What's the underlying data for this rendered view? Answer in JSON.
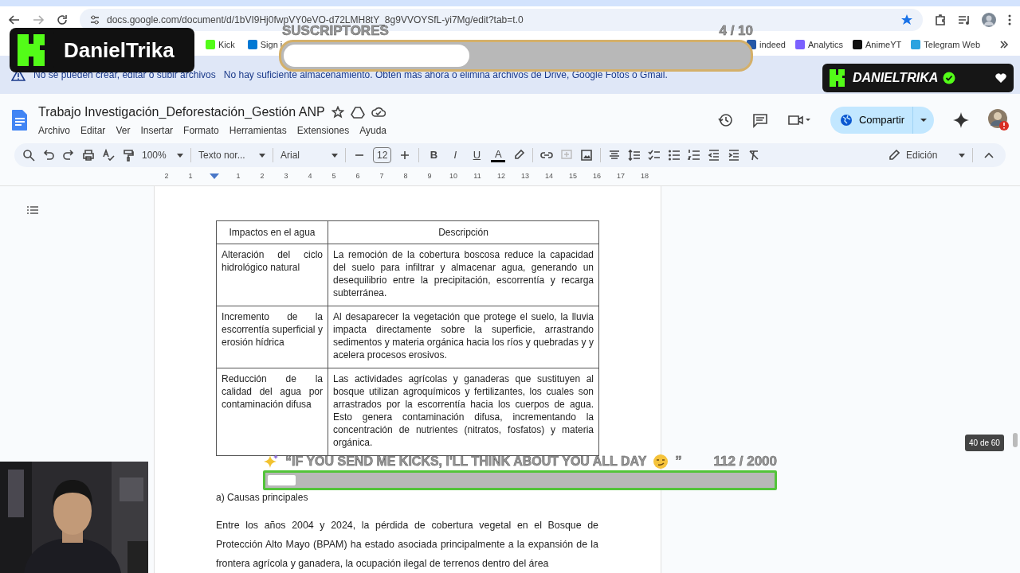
{
  "browser": {
    "url": "docs.google.com/document/d/1bVI9Hj0fwpVY0eVO-d72LMH8tY_8g9VVOYSfL-yi7Mg/edit?tab=t.0",
    "bookmarks": [
      {
        "label": "Kick",
        "color": "#53fc18"
      },
      {
        "label": "Sign i",
        "color": "#0078d4"
      },
      {
        "label": "indeed",
        "color": "#2557a7"
      },
      {
        "label": "Analytics",
        "color": "#7b61ff"
      },
      {
        "label": "AnimeYT",
        "color": "#111111"
      },
      {
        "label": "Telegram Web",
        "color": "#2aa3e0"
      }
    ]
  },
  "banner": {
    "title": "No se pueden crear, editar o subir archivos",
    "message": "No hay suficiente almacenamiento. Obtén más ahora o elimina archivos de Drive, Google Fotos o Gmail."
  },
  "doc": {
    "title": "Trabajo Investigación_Deforestación_Gestión ANP",
    "menus": [
      "Archivo",
      "Editar",
      "Ver",
      "Insertar",
      "Formato",
      "Herramientas",
      "Extensiones",
      "Ayuda"
    ],
    "share": "Compartir",
    "toolbar": {
      "zoom": "100%",
      "style": "Texto nor...",
      "font": "Arial",
      "size": "12",
      "format_letters": [
        "B",
        "I",
        "U",
        "A"
      ],
      "mode": "Edición"
    },
    "ruler": [
      "2",
      "1",
      "1",
      "2",
      "3",
      "4",
      "5",
      "6",
      "7",
      "8",
      "9",
      "10",
      "11",
      "12",
      "13",
      "14",
      "15",
      "16",
      "17",
      "18"
    ],
    "table": {
      "columns": [
        "Impactos en el agua",
        "Descripción"
      ],
      "rows": [
        [
          "Alteración del ciclo hidrológico natural",
          "La remoción de la cobertura boscosa reduce la capacidad del suelo para infiltrar y almacenar agua, generando un desequilibrio entre la precipitación, escorrentía y recarga subterránea."
        ],
        [
          "Incremento de la escorrentía superficial y erosión hídrica",
          "Al desaparecer la vegetación que protege el suelo, la lluvia impacta directamente sobre la superficie, arrastrando sedimentos y materia orgánica hacia los ríos y quebradas y y acelera procesos erosivos."
        ],
        [
          "Reducción de la calidad del agua por contaminación difusa",
          "Las actividades agrícolas y ganaderas que sustituyen al bosque utilizan agroquímicos y fertilizantes, los cuales son arrastrados por la escorrentía hacia los cuerpos de agua. Esto genera contaminación difusa, incrementando la concentración de nutrientes (nitratos, fosfatos) y materia orgánica."
        ]
      ]
    },
    "heading": "a) Causas principales",
    "paragraph": "Entre los años 2004 y 2024, la pérdida de cobertura vegetal en el Bosque de Protección Alto Mayo (BPAM) ha estado asociada principalmente a la expansión de la frontera agrícola y ganadera, la ocupación ilegal de terrenos dentro del área",
    "page_indicator": "40 de 60"
  },
  "overlays": {
    "logo": "DanielTrika",
    "badge": "DANIELTRIKA",
    "subs_goal": {
      "label": "SUSCRIPTORES",
      "count": "4  / 10",
      "level": 0.4
    },
    "kicks_goal": {
      "label": "“IF YOU SEND ME KICKS, I'LL THINK ABOUT YOU ALL DAY",
      "close_quote": "”",
      "count": "112  / 2000",
      "level": 0.056
    }
  }
}
